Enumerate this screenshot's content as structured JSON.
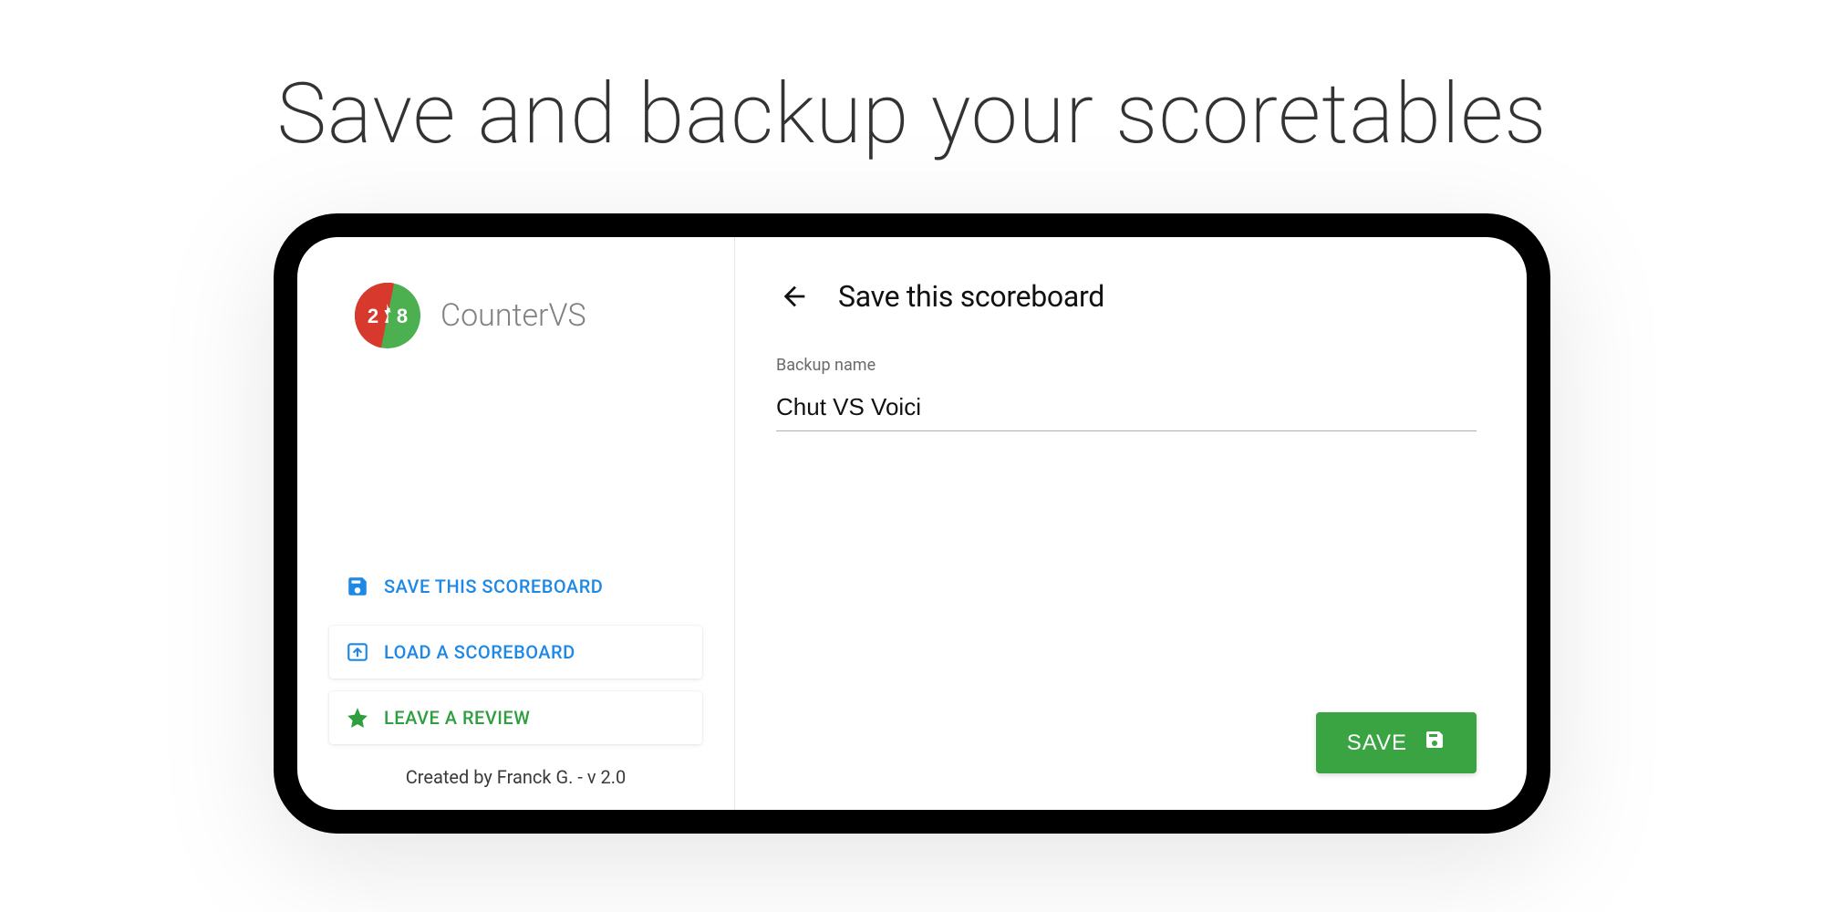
{
  "headline": "Save and backup your scoretables",
  "sidebar": {
    "app_name": "CounterVS",
    "logo": {
      "left_score": "2",
      "right_score": "8",
      "left_color": "#d73a2d",
      "right_color": "#4caf50"
    },
    "menu": [
      {
        "label": "SAVE THIS SCOREBOARD",
        "icon": "save-icon",
        "color": "blue"
      },
      {
        "label": "LOAD A SCOREBOARD",
        "icon": "upload-icon",
        "color": "blue"
      },
      {
        "label": "LEAVE A REVIEW",
        "icon": "star-icon",
        "color": "green"
      }
    ],
    "credits": "Created by Franck G. - v 2.0"
  },
  "main": {
    "title": "Save this scoreboard",
    "field_label": "Backup name",
    "input_value": "Chut VS Voici",
    "save_button": "SAVE"
  }
}
